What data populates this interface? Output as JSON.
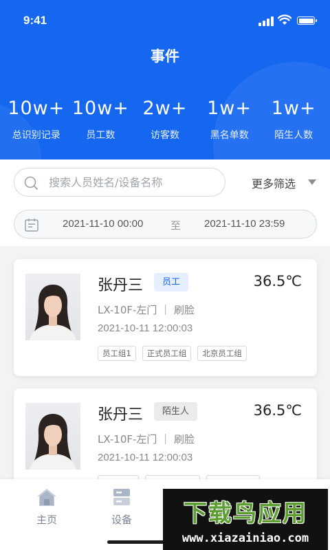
{
  "status_bar": {
    "time": "9:41"
  },
  "header": {
    "title": "事件"
  },
  "stats": [
    {
      "value": "10w+",
      "label": "总识别记录"
    },
    {
      "value": "10w+",
      "label": "员工数"
    },
    {
      "value": "2w+",
      "label": "访客数"
    },
    {
      "value": "1w+",
      "label": "黑名单数"
    },
    {
      "value": "1w+",
      "label": "陌生人数"
    }
  ],
  "search": {
    "placeholder": "搜索人员姓名/设备名称"
  },
  "filter": {
    "more_label": "更多筛选"
  },
  "date_range": {
    "start": "2021-11-10 00:00",
    "separator": "至",
    "end": "2021-11-10 23:59"
  },
  "records": [
    {
      "name": "张丹三",
      "badge": "员工",
      "temperature": "36.5℃",
      "location": "LX-10F-左门 ｜ 刷脸",
      "time": "2021-10-11 12:00:03",
      "tags": [
        "员工组1",
        "正式员工组",
        "北京员工组"
      ]
    },
    {
      "name": "张丹三",
      "badge": "陌生人",
      "temperature": "36.5℃",
      "location": "LX-10F-左门 ｜ 刷脸",
      "time": "2021-10-11 12:00:03",
      "tags": [
        "",
        "",
        ""
      ]
    }
  ],
  "tabbar": [
    {
      "label": "主页",
      "icon": "home-icon"
    },
    {
      "label": "设备",
      "icon": "device-icon"
    }
  ],
  "watermark": {
    "title": "下载鸟应用",
    "url": "www.xiazainiao.com"
  },
  "colors": {
    "primary": "#1567f0",
    "badge_employee_bg": "#e6efff",
    "badge_stranger_bg": "#ebebeb"
  }
}
